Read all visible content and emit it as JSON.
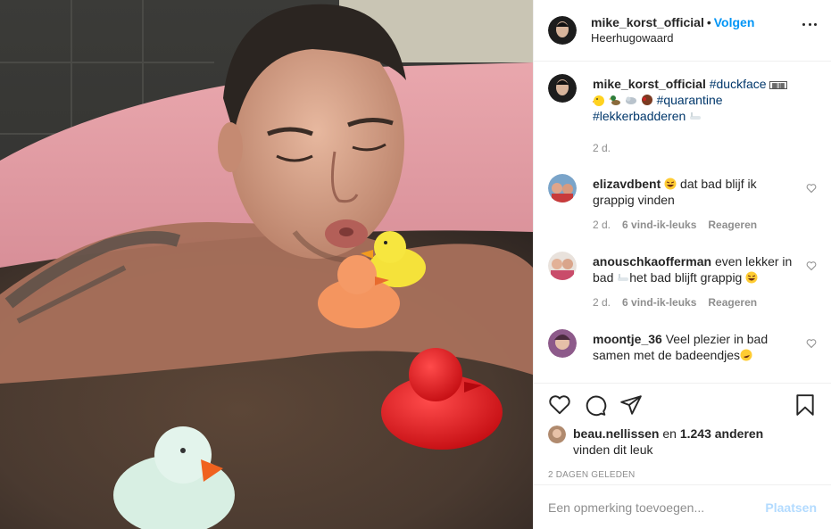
{
  "header": {
    "username": "mike_korst_official",
    "separator": "•",
    "follow_label": "Volgen",
    "location": "Heerhugowaard"
  },
  "caption": {
    "username": "mike_korst_official",
    "tag_duckface": "#duckface",
    "tag_quarantine": "#quarantine",
    "tag_lekkerbadderen": "#lekkerbadderen",
    "time": "2 d."
  },
  "comments": [
    {
      "username": "elizavdbent",
      "text": "dat bad blijf ik grappig vinden",
      "emoji": "laughing-emoji",
      "time": "2 d.",
      "likes": "6 vind-ik-leuks",
      "reply_label": "Reageren"
    },
    {
      "username": "anouschkaofferman",
      "text_a": "even lekker in bad",
      "text_b": "het bad blijft grappig",
      "emoji": "bathtub-emoji",
      "time": "2 d.",
      "likes": "6 vind-ik-leuks",
      "reply_label": "Reageren"
    },
    {
      "username": "moontje_36",
      "text": "Veel plezier in bad samen met de badeendjes",
      "emoji": "rofl-emoji"
    }
  ],
  "likes": {
    "first_liker": "beau.nellissen",
    "connector": "en",
    "others": "1.243 anderen",
    "suffix": "vinden dit leuk"
  },
  "post_date": "2 DAGEN GELEDEN",
  "add_comment": {
    "placeholder": "Een opmerking toevoegen...",
    "post_label": "Plaatsen"
  },
  "colors": {
    "link": "#0095f6",
    "hashtag": "#00376b",
    "muted": "#8e8e8e",
    "post_disabled": "#b3dbff"
  }
}
